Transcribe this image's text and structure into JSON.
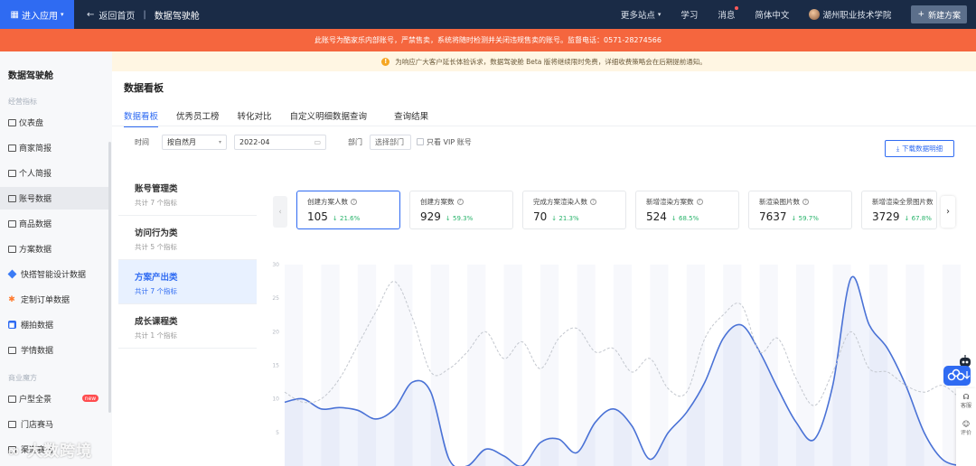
{
  "topbar": {
    "enter_app": "进入应用",
    "back_home": "返回首页",
    "page_name": "数据驾驶舱",
    "more_sites": "更多站点",
    "learn": "学习",
    "messages": "消息",
    "language": "简体中文",
    "org_name": "湖州职业技术学院",
    "new_plan": "新建方案"
  },
  "banners": {
    "red": "此账号为酷家乐内部账号，严禁售卖，系统将随时检测并关闭违规售卖的账号。监督电话：0571-28274566",
    "yellow": "为响应广大客户延长体验诉求，数据驾驶舱 Beta 版将继续限时免费，详细收费策略会在后期提前通知。"
  },
  "sidebar": {
    "title": "数据驾驶舱",
    "section1": "经营指标",
    "section2": "商业魔方",
    "items": [
      {
        "label": "仪表盘",
        "icon": "dashboard-icon"
      },
      {
        "label": "商家简报",
        "icon": "report-icon"
      },
      {
        "label": "个人简报",
        "icon": "person-icon"
      },
      {
        "label": "账号数据",
        "icon": "accounts-icon"
      },
      {
        "label": "商品数据",
        "icon": "product-icon"
      },
      {
        "label": "方案数据",
        "icon": "plan-icon"
      },
      {
        "label": "快搭智能设计数据",
        "icon": "diamond-icon"
      },
      {
        "label": "定制订单数据",
        "icon": "star-icon"
      },
      {
        "label": "棚拍数据",
        "icon": "camera-icon"
      },
      {
        "label": "学情数据",
        "icon": "study-icon"
      },
      {
        "label": "户型全景",
        "icon": "floorplan-icon",
        "badge": "new"
      },
      {
        "label": "门店赛马",
        "icon": "store-icon"
      },
      {
        "label": "渠道赛马",
        "icon": "channel-icon"
      }
    ]
  },
  "main": {
    "title": "数据看板",
    "tabs": [
      "数据看板",
      "优秀员工榜",
      "转化对比",
      "自定义明细数据查询",
      "查询结果"
    ],
    "filter": {
      "time_label": "时间",
      "granularity": "按自然月",
      "month": "2022-04",
      "dept_label": "部门",
      "dept_placeholder": "选择部门",
      "vip_only": "只看 VIP 账号"
    },
    "download": "下载数据明细",
    "categories": [
      {
        "name": "账号管理类",
        "sub": "共计 7 个指标"
      },
      {
        "name": "访问行为类",
        "sub": "共计 5 个指标"
      },
      {
        "name": "方案产出类",
        "sub": "共计 7 个指标"
      },
      {
        "name": "成长课程类",
        "sub": "共计 1 个指标"
      }
    ],
    "metrics": [
      {
        "label": "创建方案人数",
        "value": "105",
        "change": "21.6%"
      },
      {
        "label": "创建方案数",
        "value": "929",
        "change": "59.3%"
      },
      {
        "label": "完成方案渲染人数",
        "value": "70",
        "change": "21.3%"
      },
      {
        "label": "新增渲染方案数",
        "value": "524",
        "change": "68.5%"
      },
      {
        "label": "新渲染图片数",
        "value": "7637",
        "change": "59.7%"
      },
      {
        "label": "新增渲染全景图片数",
        "value": "3729",
        "change": "67.8%"
      }
    ]
  },
  "chart_data": {
    "type": "area",
    "ylim": [
      0,
      30
    ],
    "y_ticks": [
      "30",
      "25",
      "20",
      "15",
      "10",
      "5"
    ],
    "series": [
      {
        "style": "solid",
        "color": "#4a72d6",
        "values": [
          9.5,
          10,
          8.5,
          8.7,
          8.3,
          7,
          8.5,
          12.5,
          11,
          1,
          0,
          2.5,
          1.5,
          0,
          3.5,
          4,
          2,
          6.5,
          8.5,
          6,
          1,
          5,
          8,
          12.5,
          19,
          21,
          17,
          11.5,
          6.5,
          4,
          12,
          28,
          21,
          17.5,
          12,
          5,
          1,
          0
        ]
      },
      {
        "style": "dashed",
        "color": "#c4c8cf",
        "values": [
          11,
          9.5,
          10,
          13,
          18,
          23,
          27.5,
          22,
          14,
          14.5,
          17,
          20,
          16,
          18.5,
          14.5,
          19,
          20.5,
          17,
          17.5,
          14,
          16,
          11.5,
          11,
          19,
          22.5,
          24,
          17,
          19,
          13,
          9,
          14,
          20,
          14.5,
          14,
          12,
          11,
          12,
          10
        ]
      }
    ]
  },
  "float": {
    "headset": "客服",
    "rate": "评价"
  },
  "watermark": "大数跨境"
}
